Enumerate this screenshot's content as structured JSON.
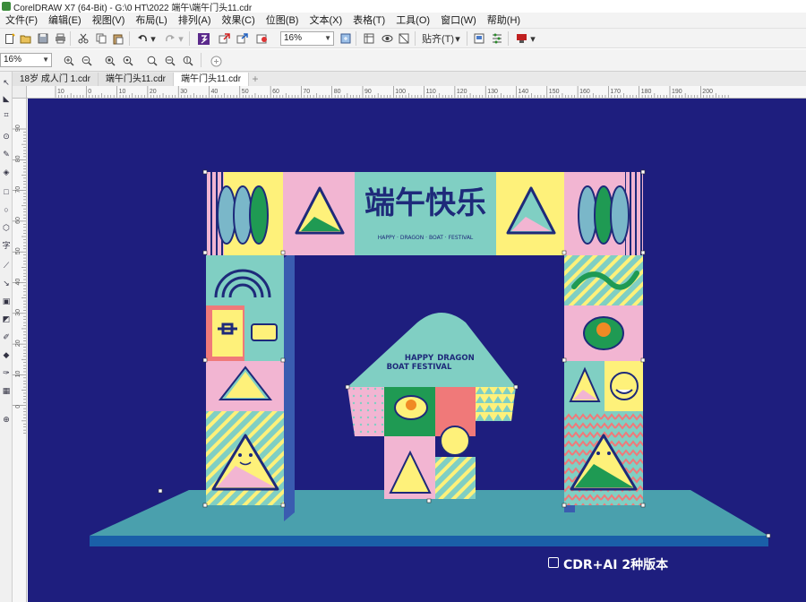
{
  "window": {
    "title": "CorelDRAW X7 (64-Bit) - G:\\0 HT\\2022 端午\\端午门头11.cdr"
  },
  "menu": [
    "文件(F)",
    "编辑(E)",
    "视图(V)",
    "布局(L)",
    "排列(A)",
    "效果(C)",
    "位图(B)",
    "文本(X)",
    "表格(T)",
    "工具(O)",
    "窗口(W)",
    "帮助(H)"
  ],
  "toolbar": {
    "zoom_value": "16%",
    "snap_label": "贴齐(T)"
  },
  "property_bar": {
    "zoom_value": "16%"
  },
  "tabs": [
    {
      "label": "18岁 成人门 1.cdr",
      "active": false
    },
    {
      "label": "端午门头11.cdr",
      "active": false
    },
    {
      "label": "端午门头11.cdr",
      "active": true
    }
  ],
  "ruler": {
    "h_labels": [
      "10",
      "0",
      "10",
      "20",
      "30",
      "40",
      "50",
      "60",
      "70",
      "80",
      "90",
      "100",
      "110",
      "120",
      "130",
      "140",
      "150",
      "160",
      "170",
      "180",
      "190",
      "200"
    ],
    "v_labels": [
      "90",
      "80",
      "70",
      "60",
      "50",
      "40",
      "30",
      "20",
      "10",
      "0"
    ]
  },
  "artwork": {
    "title_cn": "端午快乐",
    "subtitle_en": "HAPPY · DRAGON · BOAT · FESTIVAL",
    "tower_line1": "HAPPY",
    "tower_line2": "DRAGON",
    "tower_line3": "BOAT FESTIVAL",
    "background_color": "#1e1e7e",
    "teal": "#80cfc3",
    "pink": "#f2b5d2",
    "yellow": "#fef17a",
    "green": "#1f9a53",
    "coral": "#f07979"
  },
  "badge": {
    "text": "CDR+AI 2种版本"
  }
}
